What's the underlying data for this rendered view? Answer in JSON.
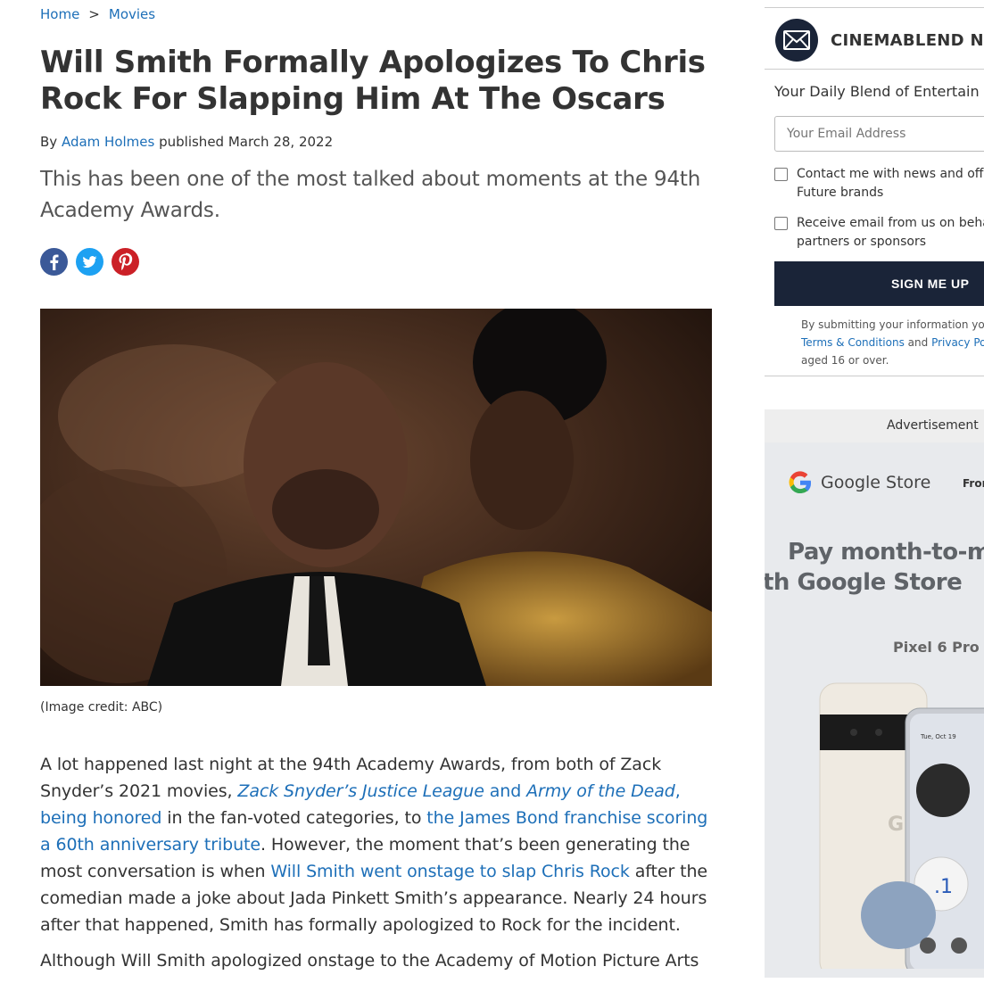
{
  "breadcrumb": {
    "home": "Home",
    "sep": ">",
    "section": "Movies"
  },
  "article": {
    "title": "Will Smith Formally Apologizes To Chris Rock For Slapping Him At The Oscars",
    "byline_prefix": "By",
    "author": "Adam Holmes",
    "published": "published March 28, 2022",
    "strapline": "This has been one of the most talked about moments at the 94th Academy Awards.",
    "image_credit": "(Image credit: ABC)",
    "p1": {
      "t1": "A lot happened last night at the 94th Academy Awards, from both of Zack Snyder’s 2021 movies, ",
      "l1a": "Zack Snyder’s Justice League",
      "l1b": " and ",
      "l1c": "Army of the Dead",
      "l1d": ", being honored",
      "t2": " in the fan-voted categories, to ",
      "l2": "the James Bond franchise scoring a 60th anniversary tribute",
      "t3": ". However, the moment that’s been generating the most conversation is when ",
      "l3": "Will Smith went onstage to slap Chris Rock",
      "t4": " after the comedian made a joke about Jada Pinkett Smith’s appearance. Nearly 24 hours after that happened, Smith has formally apologized to Rock for the incident."
    },
    "p2": "Although Will Smith apologized onstage to the Academy of Motion Picture Arts"
  },
  "share": {
    "icons": [
      "facebook-icon",
      "twitter-icon",
      "pinterest-icon"
    ]
  },
  "newsletter": {
    "title": "CINEMABLEND NE",
    "tagline": "Your Daily Blend of Entertain",
    "email_placeholder": "Your Email Address",
    "check1": "Contact me with news and offe Future brands",
    "check2": "Receive email from us on beha partners or sponsors",
    "button": "SIGN ME UP",
    "legal_1": "By submitting your information you",
    "legal_terms": "Terms & Conditions",
    "legal_and": " and ",
    "legal_privacy": "Privacy Pol",
    "legal_2": "aged 16 or over."
  },
  "ad": {
    "label": "Advertisement",
    "brand": "Google Store",
    "from": "Fron",
    "headline_1": "Pay month-to-mo",
    "headline_2": "th Google Store",
    "model": "Pixel 6 Pro"
  },
  "colors": {
    "link": "#1d6fb8",
    "navy": "#1a2438",
    "facebook": "#3b5998",
    "twitter": "#1da1f2",
    "pinterest": "#cb2027"
  }
}
